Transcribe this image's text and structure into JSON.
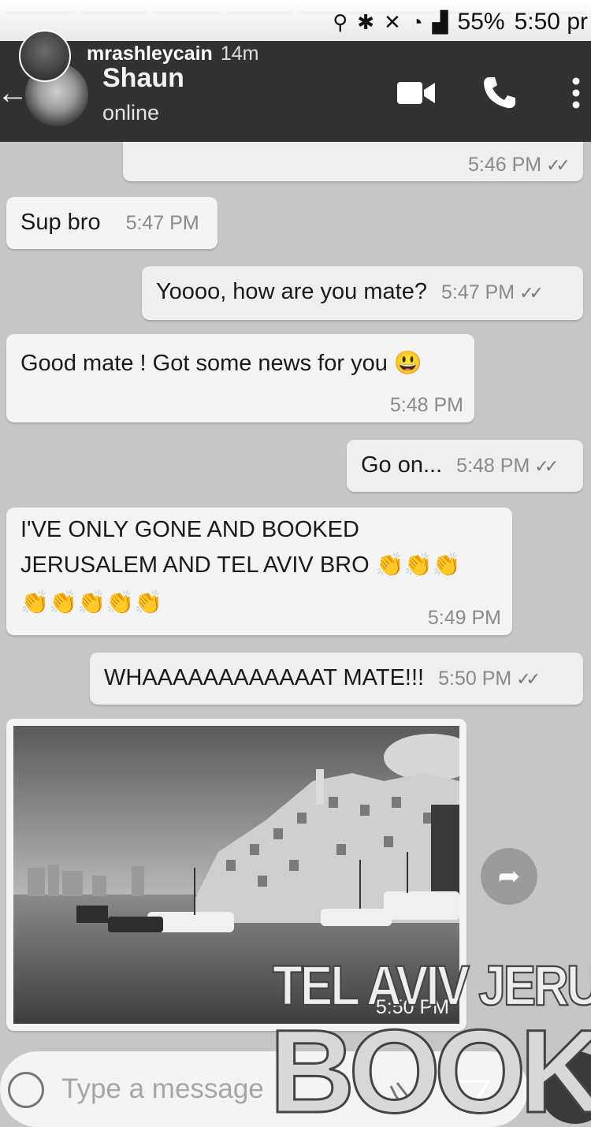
{
  "story": {
    "user": "mrashleycain",
    "age": "14m"
  },
  "status_bar": {
    "battery": "55%",
    "time": "5:50 pr"
  },
  "chat": {
    "name": "Shaun",
    "status": "online"
  },
  "messages": [
    {
      "text": "",
      "time": "5:46 PM",
      "dir": "out"
    },
    {
      "text": "Sup bro",
      "time": "5:47 PM",
      "dir": "in"
    },
    {
      "text": "Yoooo, how are you mate?",
      "time": "5:47 PM",
      "dir": "out"
    },
    {
      "text": "Good mate ! Got some news for you 😃",
      "time": "5:48 PM",
      "dir": "in"
    },
    {
      "text": "Go on...",
      "time": "5:48 PM",
      "dir": "out"
    },
    {
      "line1": "I'VE ONLY GONE AND BOOKED",
      "line2": "JERUSALEM AND TEL AVIV BRO 👏👏👏",
      "line3": "👏👏👏👏👏",
      "time": "5:49 PM",
      "dir": "in"
    },
    {
      "text": "WHAAAAAAAAAAAAT MATE!!!",
      "time": "5:50 PM",
      "dir": "out"
    },
    {
      "time": "5:50 PM",
      "dir": "in"
    }
  ],
  "overlay": {
    "line1": "TEL AVIV JERUSALEM",
    "line2": "BOOKED"
  },
  "composer": {
    "placeholder": "Type a message"
  },
  "ticks": "✓✓"
}
